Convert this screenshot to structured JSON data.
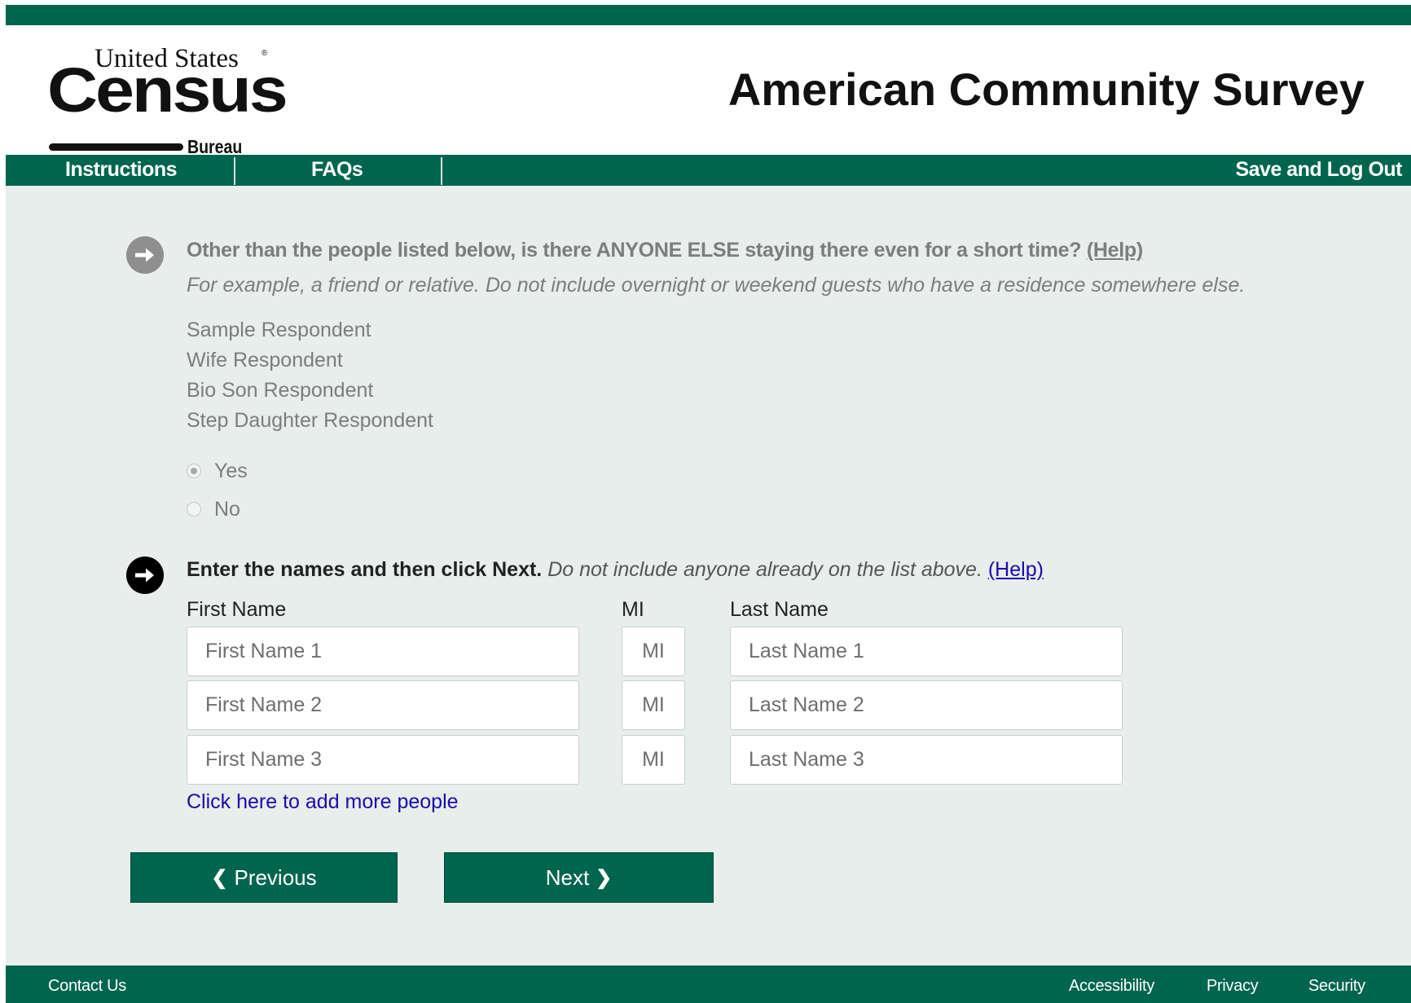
{
  "logo": {
    "line1": "United States",
    "registered": "®",
    "line2": "Census",
    "line3": "Bureau"
  },
  "header": {
    "title": "American Community Survey"
  },
  "nav": {
    "instructions": "Instructions",
    "faqs": "FAQs",
    "logout": "Save and Log Out"
  },
  "q1": {
    "text": "Other than the people listed below, is there ANYONE ELSE staying there even for a short time?",
    "help": "(Help)",
    "hint": "For example, a friend or relative. Do not include overnight or weekend guests who have a residence somewhere else.",
    "people": [
      "Sample Respondent",
      "Wife Respondent",
      "Bio Son Respondent",
      "Step Daughter Respondent"
    ],
    "options": {
      "yes": "Yes",
      "no": "No"
    },
    "selected": "Yes"
  },
  "q2": {
    "bold": "Enter the names and then click Next.",
    "italic": "Do not include anyone already on the list above.",
    "help": "(Help)"
  },
  "columns": {
    "first": "First Name",
    "mi": "MI",
    "last": "Last Name"
  },
  "rows": [
    {
      "first_placeholder": "First Name 1",
      "mi_placeholder": "MI",
      "last_placeholder": "Last Name 1"
    },
    {
      "first_placeholder": "First Name 2",
      "mi_placeholder": "MI",
      "last_placeholder": "Last Name 2"
    },
    {
      "first_placeholder": "First Name 3",
      "mi_placeholder": "MI",
      "last_placeholder": "Last Name 3"
    }
  ],
  "add_more": "Click here to add more people",
  "buttons": {
    "previous": "Previous",
    "next": "Next"
  },
  "icons": {
    "question_inactive": "arrow-circle-right-icon (gray)",
    "question_active": "arrow-circle-right-icon (black)",
    "prev": "chevron-left-icon",
    "next": "chevron-right-icon"
  },
  "colors": {
    "brand_green": "#00654e",
    "page_bg": "#e7eeeb",
    "link_blue": "#1a0dab",
    "disabled_text": "#7d7d7d"
  },
  "footer": {
    "contact": "Contact Us",
    "accessibility": "Accessibility",
    "privacy": "Privacy",
    "security": "Security"
  }
}
